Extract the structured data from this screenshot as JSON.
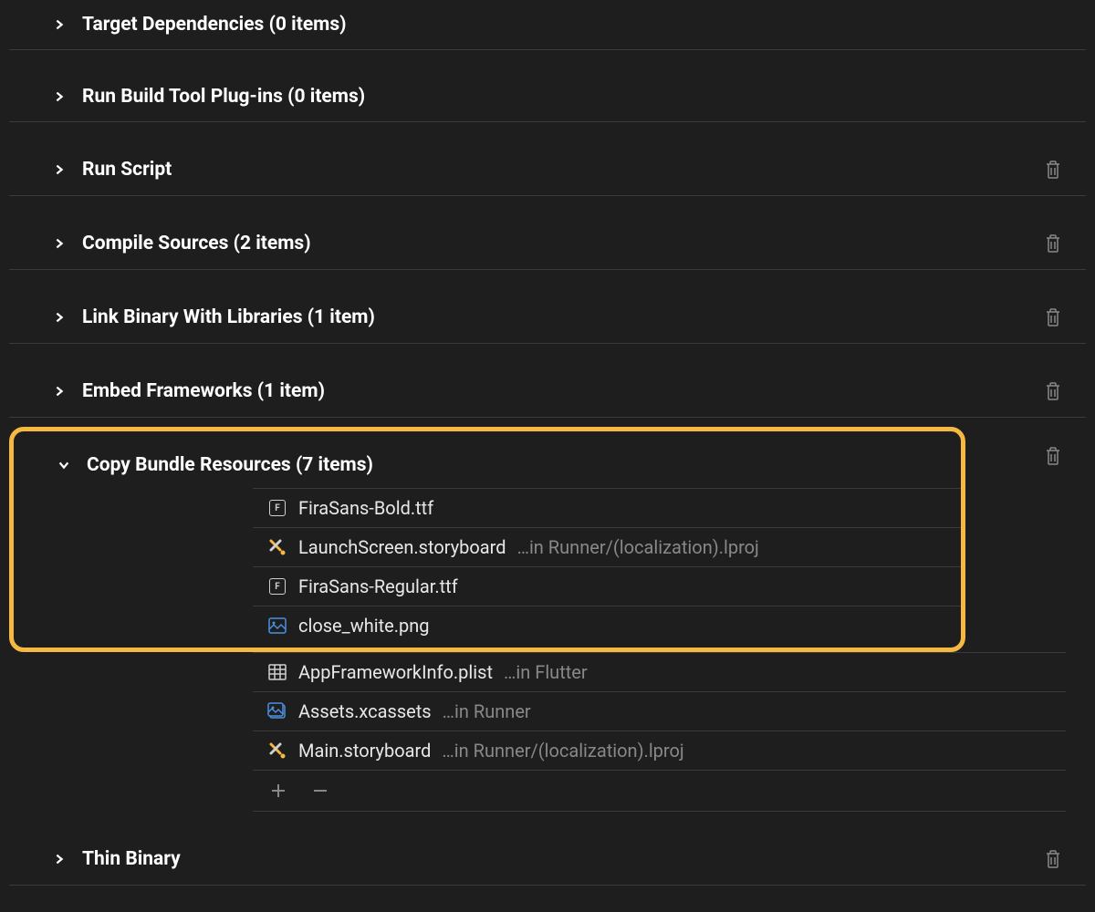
{
  "phases": [
    {
      "id": "target-deps",
      "title": "Target Dependencies (0 items)",
      "expanded": false,
      "hasTrash": false
    },
    {
      "id": "plugins",
      "title": "Run Build Tool Plug-ins (0 items)",
      "expanded": false,
      "hasTrash": false
    },
    {
      "id": "run-script",
      "title": "Run Script",
      "expanded": false,
      "hasTrash": true
    },
    {
      "id": "compile",
      "title": "Compile Sources (2 items)",
      "expanded": false,
      "hasTrash": true
    },
    {
      "id": "link",
      "title": "Link Binary With Libraries (1 item)",
      "expanded": false,
      "hasTrash": true
    },
    {
      "id": "embed",
      "title": "Embed Frameworks (1 item)",
      "expanded": false,
      "hasTrash": true
    },
    {
      "id": "copy",
      "title": "Copy Bundle Resources (7 items)",
      "expanded": true,
      "hasTrash": true,
      "highlighted": true
    },
    {
      "id": "thin",
      "title": "Thin Binary",
      "expanded": false,
      "hasTrash": true
    }
  ],
  "copyItems": [
    {
      "icon": "font",
      "name": "FiraSans-Bold.ttf",
      "path": ""
    },
    {
      "icon": "storyboard",
      "name": "LaunchScreen.storyboard",
      "path": "…in Runner/(localization).lproj"
    },
    {
      "icon": "font",
      "name": "FiraSans-Regular.ttf",
      "path": ""
    },
    {
      "icon": "image",
      "name": "close_white.png",
      "path": ""
    },
    {
      "icon": "plist",
      "name": "AppFrameworkInfo.plist",
      "path": "…in Flutter"
    },
    {
      "icon": "assets",
      "name": "Assets.xcassets",
      "path": "…in Runner"
    },
    {
      "icon": "storyboard",
      "name": "Main.storyboard",
      "path": "…in Runner/(localization).lproj"
    }
  ]
}
